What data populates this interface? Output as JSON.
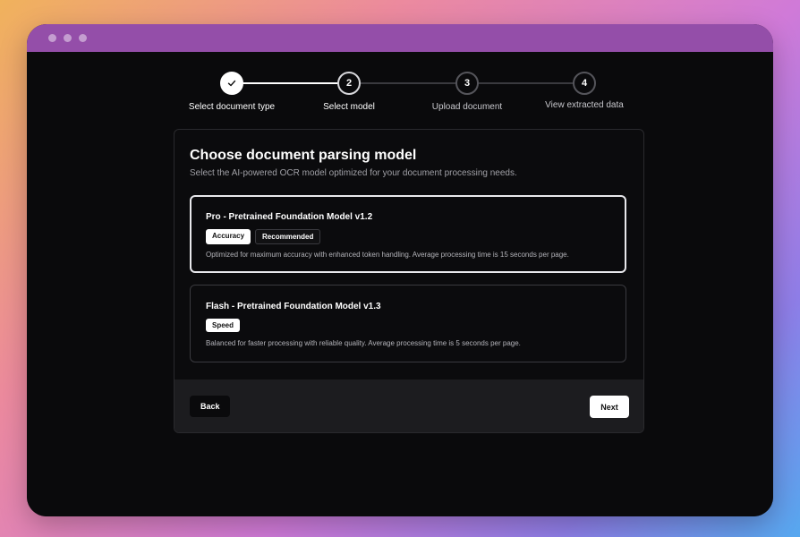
{
  "stepper": {
    "steps": [
      {
        "number": "1",
        "label": "Select document type",
        "state": "completed"
      },
      {
        "number": "2",
        "label": "Select model",
        "state": "current"
      },
      {
        "number": "3",
        "label": "Upload document",
        "state": "upcoming"
      },
      {
        "number": "4",
        "label": "View extracted data",
        "state": "upcoming"
      }
    ]
  },
  "card": {
    "title": "Choose document parsing model",
    "subtitle": "Select the AI-powered OCR model optimized for your document processing needs."
  },
  "options": [
    {
      "title": "Pro - Pretrained Foundation Model v1.2",
      "badges": [
        "Accuracy",
        "Recommended"
      ],
      "description": "Optimized for maximum accuracy with enhanced token handling. Average processing time is 15 seconds per page.",
      "selected": true
    },
    {
      "title": "Flash - Pretrained Foundation Model v1.3",
      "badges": [
        "Speed"
      ],
      "description": "Balanced for faster processing with reliable quality. Average processing time is 5 seconds per page.",
      "selected": false
    }
  ],
  "footer": {
    "back_label": "Back",
    "next_label": "Next"
  },
  "colors": {
    "window_titlebar": "#944ea9",
    "background": "#0a0a0c",
    "footer": "#1c1c1f",
    "accent": "#ffffff"
  }
}
